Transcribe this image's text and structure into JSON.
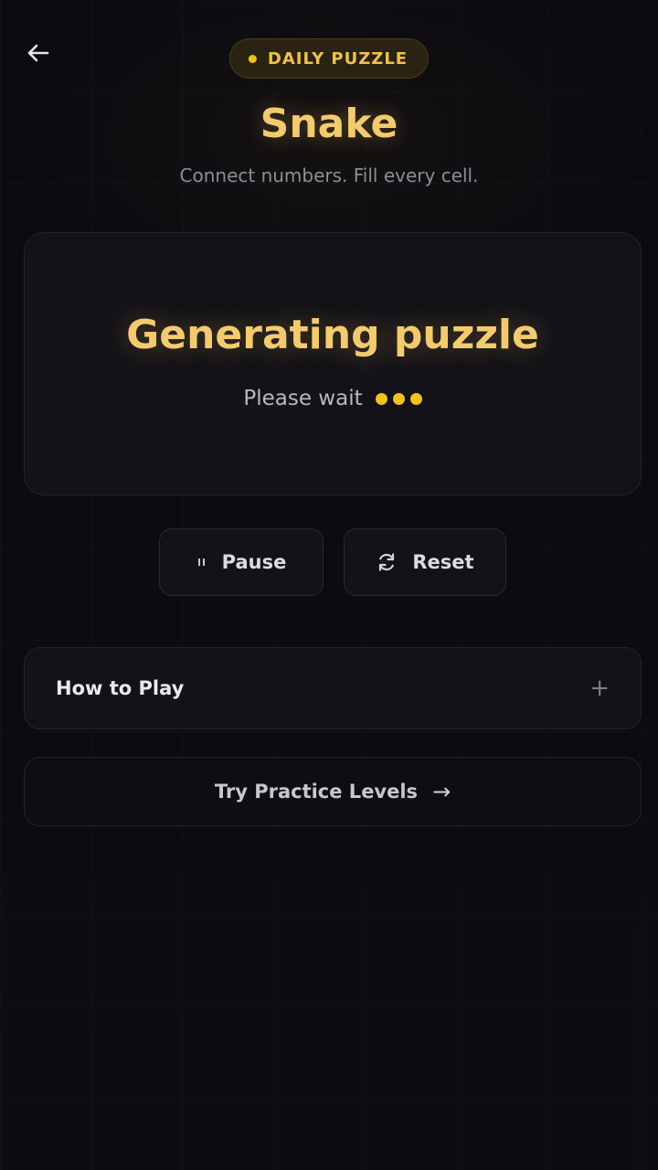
{
  "header": {
    "badge_label": "DAILY PUZZLE",
    "title": "Snake",
    "subtitle": "Connect numbers. Fill every cell."
  },
  "status": {
    "title": "Generating puzzle",
    "message": "Please wait"
  },
  "controls": {
    "pause_label": "Pause",
    "reset_label": "Reset"
  },
  "how_to_play": {
    "label": "How to Play",
    "expand_symbol": "+"
  },
  "practice": {
    "label": "Try Practice Levels",
    "arrow_symbol": "→"
  },
  "icons": {
    "back": "arrow-left-icon",
    "pause": "pause-icon",
    "reset": "refresh-icon",
    "expand": "plus-icon",
    "practice": "arrow-right-icon"
  },
  "colors": {
    "accent": "#f3cb6e",
    "dot": "#f2c21b",
    "background": "#0b0a10",
    "card": "#131218"
  }
}
